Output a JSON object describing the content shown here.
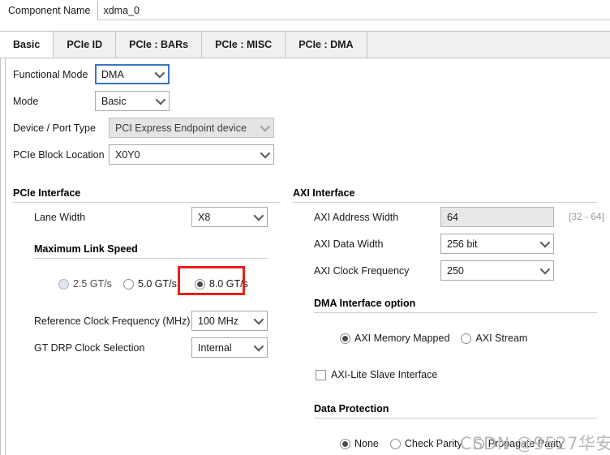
{
  "header": {
    "component_name_label": "Component Name",
    "component_name_value": "xdma_0"
  },
  "tabs": [
    {
      "label": "Basic",
      "active": true
    },
    {
      "label": "PCIe ID",
      "active": false
    },
    {
      "label": "PCIe : BARs",
      "active": false
    },
    {
      "label": "PCIe : MISC",
      "active": false
    },
    {
      "label": "PCIe : DMA",
      "active": false
    }
  ],
  "left": {
    "functional_mode": {
      "label": "Functional Mode",
      "value": "DMA"
    },
    "mode": {
      "label": "Mode",
      "value": "Basic"
    },
    "device_port_type": {
      "label": "Device / Port Type",
      "value": "PCI Express Endpoint device"
    },
    "pcie_block_location": {
      "label": "PCIe Block Location",
      "value": "X0Y0"
    },
    "pcie_interface_title": "PCIe Interface",
    "lane_width": {
      "label": "Lane Width",
      "value": "X8"
    },
    "max_link_speed_title": "Maximum Link Speed",
    "link_speed_options": [
      {
        "label": "2.5 GT/s",
        "checked": false,
        "disabled": true
      },
      {
        "label": "5.0 GT/s",
        "checked": false,
        "disabled": false
      },
      {
        "label": "8.0 GT/s",
        "checked": true,
        "disabled": false
      }
    ],
    "ref_clock_freq": {
      "label": "Reference Clock Frequency (MHz)",
      "value": "100 MHz"
    },
    "gt_drp_clock": {
      "label": "GT DRP Clock Selection",
      "value": "Internal"
    }
  },
  "right": {
    "axi_interface_title": "AXI Interface",
    "axi_address_width": {
      "label": "AXI Address Width",
      "value": "64",
      "hint": "[32 - 64]"
    },
    "axi_data_width": {
      "label": "AXI Data Width",
      "value": "256 bit"
    },
    "axi_clock_frequency": {
      "label": "AXI Clock Frequency",
      "value": "250"
    },
    "dma_interface_title": "DMA Interface option",
    "dma_options": [
      {
        "label": "AXI Memory Mapped",
        "checked": true
      },
      {
        "label": "AXI Stream",
        "checked": false
      }
    ],
    "axi_lite_slave": {
      "label": "AXI-Lite Slave Interface",
      "checked": false
    },
    "data_protection_title": "Data Protection",
    "data_protection_options": [
      {
        "label": "None",
        "checked": true
      },
      {
        "label": "Check Parity",
        "checked": false
      },
      {
        "label": "Propagate Parity",
        "checked": false
      }
    ]
  },
  "watermark": {
    "text": "CSDN @9527华安"
  },
  "colors": {
    "accent_focus": "#3a76c4",
    "annotation_red": "#e8201a",
    "tab_bar_bg": "#f0f0f0"
  }
}
